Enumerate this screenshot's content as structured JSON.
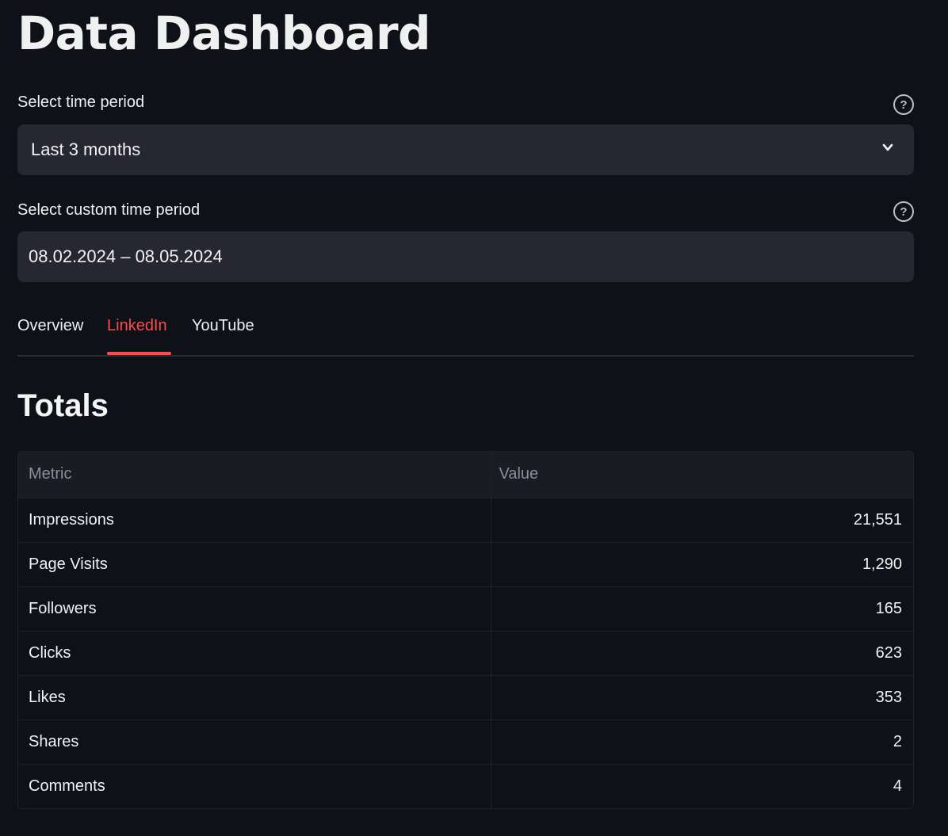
{
  "page": {
    "title": "Data Dashboard"
  },
  "time_period": {
    "label": "Select time period",
    "selected": "Last 3 months",
    "help_icon": "question-circle-icon",
    "dropdown_icon": "chevron-down-icon"
  },
  "custom_period": {
    "label": "Select custom time period",
    "value": "08.02.2024 – 08.05.2024",
    "help_icon": "question-circle-icon"
  },
  "tabs": [
    {
      "label": "Overview",
      "active": false
    },
    {
      "label": "LinkedIn",
      "active": true
    },
    {
      "label": "YouTube",
      "active": false
    }
  ],
  "totals": {
    "title": "Totals",
    "columns": [
      "Metric",
      "Value"
    ],
    "rows": [
      {
        "metric": "Impressions",
        "value": "21,551"
      },
      {
        "metric": "Page Visits",
        "value": "1,290"
      },
      {
        "metric": "Followers",
        "value": "165"
      },
      {
        "metric": "Clicks",
        "value": "623"
      },
      {
        "metric": "Likes",
        "value": "353"
      },
      {
        "metric": "Shares",
        "value": "2"
      },
      {
        "metric": "Comments",
        "value": "4"
      }
    ]
  },
  "colors": {
    "background": "#0e1117",
    "input_background": "#262730",
    "accent": "#ff4b4b",
    "header_text": "#8c8e99"
  }
}
